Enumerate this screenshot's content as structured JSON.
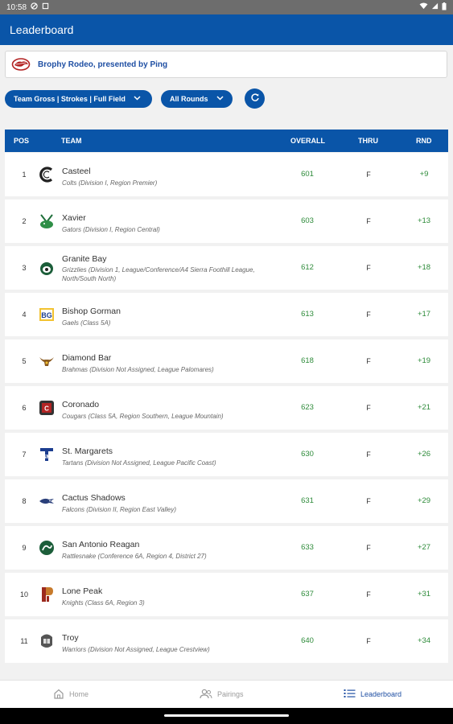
{
  "status_bar": {
    "time": "10:58"
  },
  "app_bar": {
    "title": "Leaderboard"
  },
  "event": {
    "title": "Brophy Rodeo, presented by Ping"
  },
  "filters": {
    "scoring": "Team Gross | Strokes | Full Field",
    "rounds": "All Rounds",
    "refresh_icon": "refresh-icon"
  },
  "table": {
    "headers": {
      "pos": "POS",
      "team": "TEAM",
      "overall": "OVERALL",
      "thru": "THRU",
      "rnd": "RND"
    },
    "rows": [
      {
        "pos": "1",
        "team": "Casteel",
        "sub": "Colts (Division I, Region Premier)",
        "overall": "601",
        "thru": "F",
        "rnd": "+9",
        "logo": "casteel-logo"
      },
      {
        "pos": "2",
        "team": "Xavier",
        "sub": "Gators (Division I, Region Central)",
        "overall": "603",
        "thru": "F",
        "rnd": "+13",
        "logo": "xavier-logo"
      },
      {
        "pos": "3",
        "team": "Granite Bay",
        "sub": "Grizzlies (Division 1, League/Conference/A4 Sierra Foothill League, North/South North)",
        "overall": "612",
        "thru": "F",
        "rnd": "+18",
        "logo": "granite-bay-logo"
      },
      {
        "pos": "4",
        "team": "Bishop Gorman",
        "sub": "Gaels (Class 5A)",
        "overall": "613",
        "thru": "F",
        "rnd": "+17",
        "logo": "bishop-gorman-logo"
      },
      {
        "pos": "5",
        "team": "Diamond Bar",
        "sub": "Brahmas (Division Not Assigned, League Palomares)",
        "overall": "618",
        "thru": "F",
        "rnd": "+19",
        "logo": "diamond-bar-logo"
      },
      {
        "pos": "6",
        "team": "Coronado",
        "sub": "Cougars (Class 5A, Region Southern, League Mountain)",
        "overall": "623",
        "thru": "F",
        "rnd": "+21",
        "logo": "coronado-logo"
      },
      {
        "pos": "7",
        "team": "St. Margarets",
        "sub": "Tartans (Division Not Assigned, League Pacific Coast)",
        "overall": "630",
        "thru": "F",
        "rnd": "+26",
        "logo": "st-margarets-logo"
      },
      {
        "pos": "8",
        "team": "Cactus Shadows",
        "sub": "Falcons (Division II, Region East Valley)",
        "overall": "631",
        "thru": "F",
        "rnd": "+29",
        "logo": "cactus-shadows-logo"
      },
      {
        "pos": "9",
        "team": "San Antonio Reagan",
        "sub": "Rattlesnake (Conference 6A, Region 4, District 27)",
        "overall": "633",
        "thru": "F",
        "rnd": "+27",
        "logo": "san-antonio-reagan-logo"
      },
      {
        "pos": "10",
        "team": "Lone Peak",
        "sub": "Knights (Class 6A, Region 3)",
        "overall": "637",
        "thru": "F",
        "rnd": "+31",
        "logo": "lone-peak-logo"
      },
      {
        "pos": "11",
        "team": "Troy",
        "sub": "Warriors (Division Not Assigned, League Crestview)",
        "overall": "640",
        "thru": "F",
        "rnd": "+34",
        "logo": "troy-logo"
      }
    ]
  },
  "bottom_nav": {
    "items": [
      {
        "label": "Home",
        "icon": "home-icon"
      },
      {
        "label": "Pairings",
        "icon": "people-icon"
      },
      {
        "label": "Leaderboard",
        "icon": "list-icon"
      }
    ]
  },
  "colors": {
    "primary": "#0a55a8",
    "score_green": "#2e8b3a",
    "background": "#f1f1f1"
  }
}
